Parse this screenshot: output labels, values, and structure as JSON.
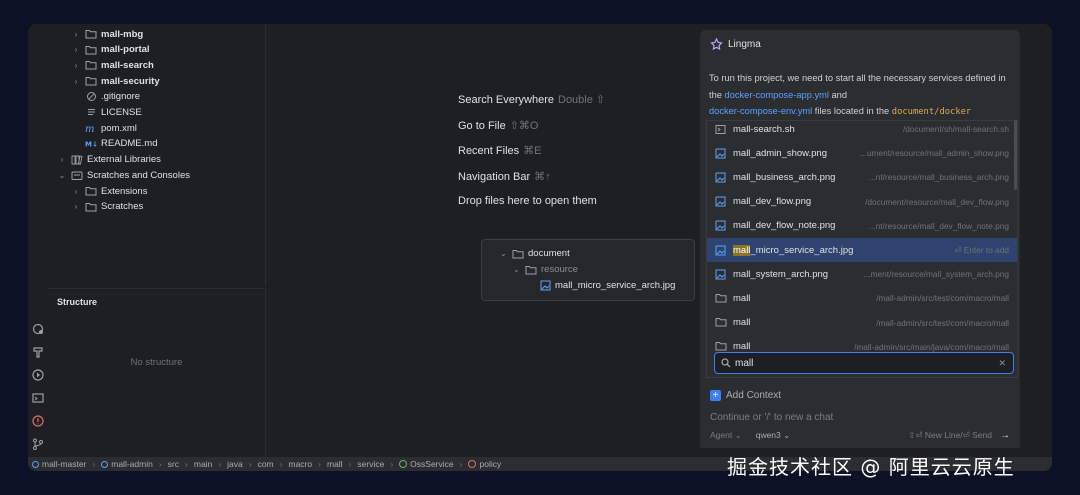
{
  "project_tree": [
    {
      "label": "mall-mbg",
      "bold": true,
      "indent": 1,
      "chev": "›",
      "icon": "folder-icon"
    },
    {
      "label": "mall-portal",
      "bold": true,
      "indent": 1,
      "chev": "›",
      "icon": "folder-icon"
    },
    {
      "label": "mall-search",
      "bold": true,
      "indent": 1,
      "chev": "›",
      "icon": "folder-icon"
    },
    {
      "label": "mall-security",
      "bold": true,
      "indent": 1,
      "chev": "›",
      "icon": "folder-icon"
    },
    {
      "label": ".gitignore",
      "bold": false,
      "indent": 1,
      "chev": "",
      "icon": "ignore-file-icon"
    },
    {
      "label": "LICENSE",
      "bold": false,
      "indent": 1,
      "chev": "",
      "icon": "text-file-icon"
    },
    {
      "label": "pom.xml",
      "bold": false,
      "indent": 1,
      "chev": "",
      "icon": "maven-icon"
    },
    {
      "label": "README.md",
      "bold": false,
      "indent": 1,
      "chev": "",
      "icon": "markdown-icon"
    },
    {
      "label": "External Libraries",
      "bold": false,
      "indent": 0,
      "chev": "›",
      "icon": "library-icon"
    },
    {
      "label": "Scratches and Consoles",
      "bold": false,
      "indent": 0,
      "chev": "⌄",
      "icon": "scratch-icon"
    },
    {
      "label": "Extensions",
      "bold": false,
      "indent": 1,
      "chev": "›",
      "icon": "folder-icon"
    },
    {
      "label": "Scratches",
      "bold": false,
      "indent": 1,
      "chev": "›",
      "icon": "folder-icon"
    }
  ],
  "structure": {
    "title": "Structure",
    "empty": "No structure"
  },
  "editor_hints": [
    {
      "label": "Search Everywhere",
      "key": "Double ⇧"
    },
    {
      "label": "Go to File",
      "key": "⇧⌘O"
    },
    {
      "label": "Recent Files",
      "key": "⌘E"
    },
    {
      "label": "Navigation Bar",
      "key": "⌘↑"
    },
    {
      "label": "Drop files here to open them",
      "key": ""
    }
  ],
  "drag_preview": {
    "folder1": "document",
    "folder2": "resource",
    "file": "mall_micro_service_arch.jpg"
  },
  "lingma": {
    "title": "Lingma",
    "msg_1": "To run this project, we need to start all the necessary services defined in the",
    "link_1": "docker-compose-app.yml",
    "msg_2": "and",
    "link_2": "docker-compose-env.yml",
    "msg_3": "files located in the",
    "code_1": "document/docker"
  },
  "popup_items": [
    {
      "name": "mall-search.sh",
      "path": "/document/sh/mall-search.sh",
      "icon": "terminal-file-icon",
      "selected": false
    },
    {
      "name": "mall_admin_show.png",
      "path": "...ument/resource/mall_admin_show.png",
      "icon": "image-icon",
      "selected": false
    },
    {
      "name": "mall_business_arch.png",
      "path": "...nt/resource/mall_business_arch.png",
      "icon": "image-icon",
      "selected": false
    },
    {
      "name": "mall_dev_flow.png",
      "path": "/document/resource/mall_dev_flow.png",
      "icon": "image-icon",
      "selected": false
    },
    {
      "name": "mall_dev_flow_note.png",
      "path": "...nt/resource/mall_dev_flow_note.png",
      "icon": "image-icon",
      "selected": false
    },
    {
      "name": "mall_micro_service_arch.jpg",
      "path": "⏎ Enter to add",
      "icon": "image-icon",
      "selected": true
    },
    {
      "name": "mall_system_arch.png",
      "path": "...ment/resource/mall_system_arch.png",
      "icon": "image-icon",
      "selected": false
    },
    {
      "name": "mall",
      "path": "/mall-admin/src/test/com/macro/mall",
      "icon": "folder-icon",
      "selected": false
    },
    {
      "name": "mall",
      "path": "/mall-admin/src/test/com/macro/mall",
      "icon": "folder-icon",
      "selected": false
    },
    {
      "name": "mall",
      "path": "/mall-admin/src/main/java/com/macro/mall",
      "icon": "folder-icon",
      "selected": false
    }
  ],
  "search": {
    "value": "mall"
  },
  "composer": {
    "add_context": "Add Context",
    "placeholder": "Continue or '/' to new a chat",
    "agent": "Agent",
    "model": "qwen3",
    "shortcut": "⇧⏎ New Line/⏎ Send"
  },
  "breadcrumbs": [
    "mall-master",
    "mall-admin",
    "src",
    "main",
    "java",
    "com",
    "macro",
    "mall",
    "service",
    "OssService",
    "policy"
  ],
  "watermark": "掘金技术社区 @ 阿里云云原生"
}
